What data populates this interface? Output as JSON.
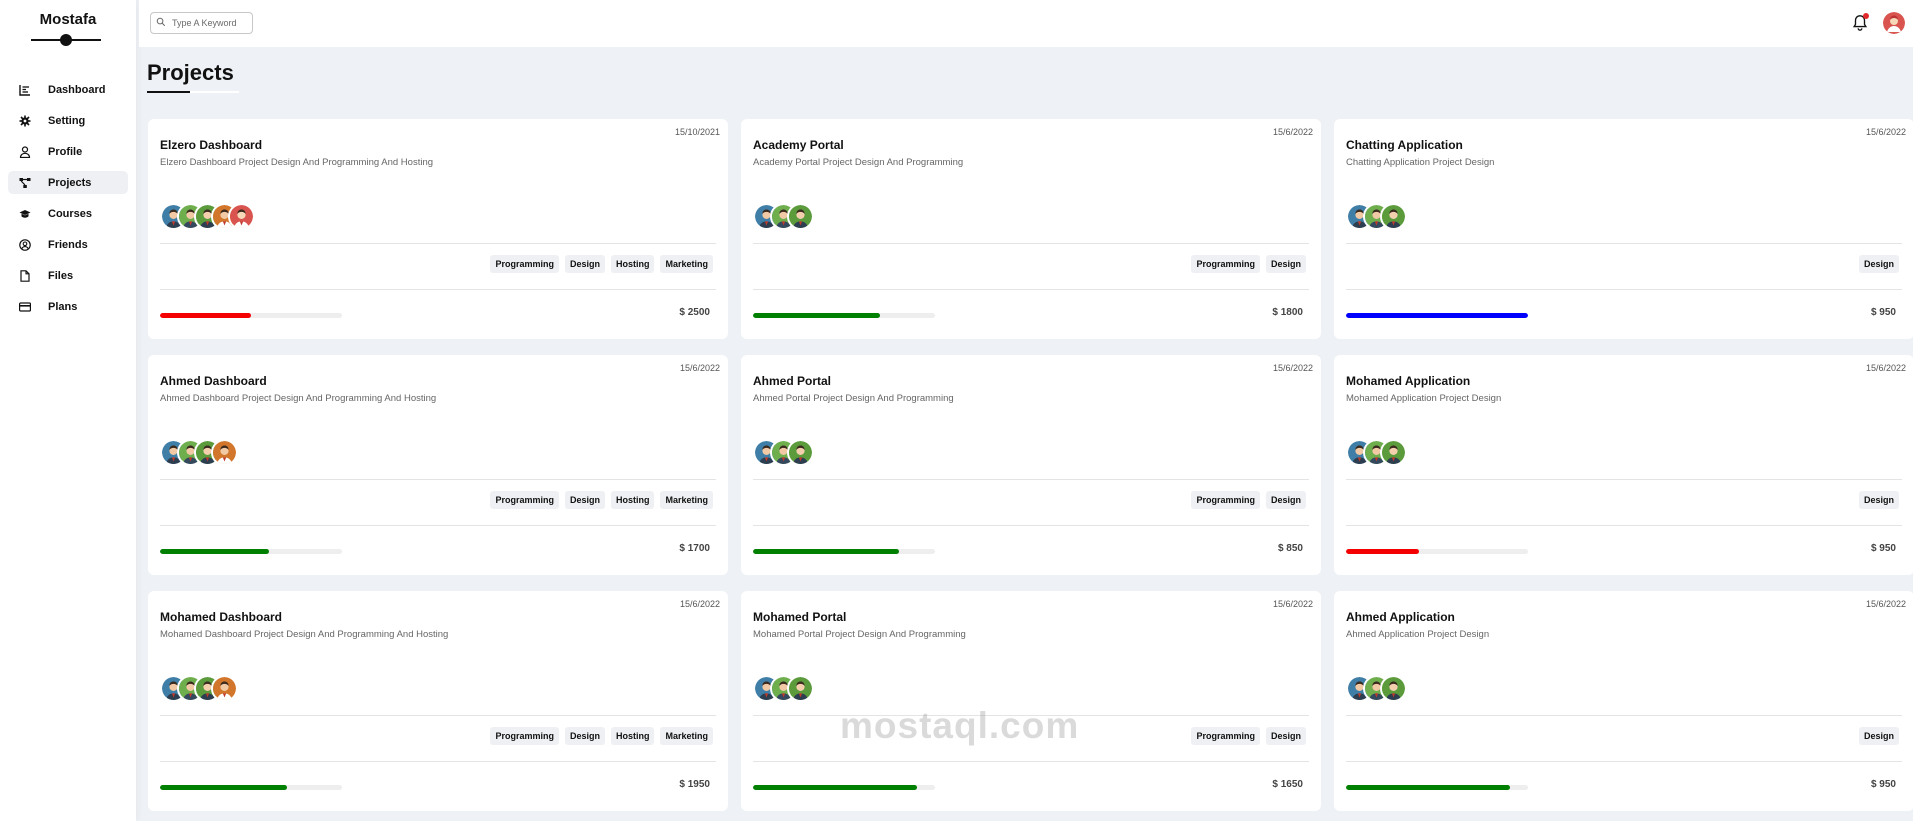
{
  "brand": {
    "name": "Mostafa"
  },
  "nav": [
    {
      "label": "Dashboard",
      "icon": "chart-icon",
      "active": false
    },
    {
      "label": "Setting",
      "icon": "gear-icon",
      "active": false
    },
    {
      "label": "Profile",
      "icon": "user-icon",
      "active": false
    },
    {
      "label": "Projects",
      "icon": "diagram-icon",
      "active": true
    },
    {
      "label": "Courses",
      "icon": "graduation-cap-icon",
      "active": false
    },
    {
      "label": "Friends",
      "icon": "user-circle-icon",
      "active": false
    },
    {
      "label": "Files",
      "icon": "file-icon",
      "active": false
    },
    {
      "label": "Plans",
      "icon": "credit-card-icon",
      "active": false
    }
  ],
  "header": {
    "search_placeholder": "Type A Keyword"
  },
  "page": {
    "title": "Projects"
  },
  "colors": {
    "red": "#f40000",
    "green": "#008000",
    "blue": "#0000ff"
  },
  "projects": [
    {
      "date": "15/10/2021",
      "title": "Elzero Dashboard",
      "desc": "Elzero Dashboard Project Design And Programming And Hosting",
      "avatars": 5,
      "tags": [
        "Programming",
        "Design",
        "Hosting",
        "Marketing"
      ],
      "progress": 0.5,
      "color": "#f40000",
      "price": "$ 2500"
    },
    {
      "date": "15/6/2022",
      "title": "Academy Portal",
      "desc": "Academy Portal Project Design And Programming",
      "avatars": 3,
      "tags": [
        "Programming",
        "Design"
      ],
      "progress": 0.7,
      "color": "#008000",
      "price": "$ 1800"
    },
    {
      "date": "15/6/2022",
      "title": "Chatting Application",
      "desc": "Chatting Application Project Design",
      "avatars": 3,
      "tags": [
        "Design"
      ],
      "progress": 1.0,
      "color": "#0000ff",
      "price": "$ 950"
    },
    {
      "date": "15/6/2022",
      "title": "Ahmed Dashboard",
      "desc": "Ahmed Dashboard Project Design And Programming And Hosting",
      "avatars": 4,
      "tags": [
        "Programming",
        "Design",
        "Hosting",
        "Marketing"
      ],
      "progress": 0.6,
      "color": "#008000",
      "price": "$ 1700"
    },
    {
      "date": "15/6/2022",
      "title": "Ahmed Portal",
      "desc": "Ahmed Portal Project Design And Programming",
      "avatars": 3,
      "tags": [
        "Programming",
        "Design"
      ],
      "progress": 0.8,
      "color": "#008000",
      "price": "$ 850"
    },
    {
      "date": "15/6/2022",
      "title": "Mohamed Application",
      "desc": "Mohamed Application Project Design",
      "avatars": 3,
      "tags": [
        "Design"
      ],
      "progress": 0.4,
      "color": "#f40000",
      "price": "$ 950"
    },
    {
      "date": "15/6/2022",
      "title": "Mohamed Dashboard",
      "desc": "Mohamed Dashboard Project Design And Programming And Hosting",
      "avatars": 4,
      "tags": [
        "Programming",
        "Design",
        "Hosting",
        "Marketing"
      ],
      "progress": 0.7,
      "color": "#008000",
      "price": "$ 1950"
    },
    {
      "date": "15/6/2022",
      "title": "Mohamed Portal",
      "desc": "Mohamed Portal Project Design And Programming",
      "avatars": 3,
      "tags": [
        "Programming",
        "Design"
      ],
      "progress": 0.9,
      "color": "#008000",
      "price": "$ 1650"
    },
    {
      "date": "15/6/2022",
      "title": "Ahmed Application",
      "desc": "Ahmed Application Project Design",
      "avatars": 3,
      "tags": [
        "Design"
      ],
      "progress": 0.9,
      "color": "#008000",
      "price": "$ 950"
    }
  ],
  "watermark": {
    "text": "mostaql.com"
  }
}
